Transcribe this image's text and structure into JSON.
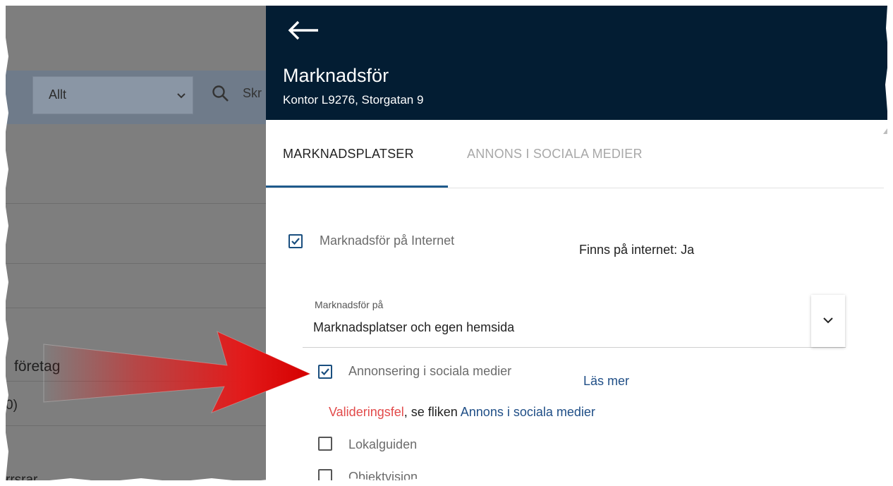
{
  "background": {
    "filter_select": "Allt",
    "search_partial": "Skr",
    "row_company": "företag",
    "row_count": "0)",
    "row_partial": "rrsrar"
  },
  "panel": {
    "title": "Marknadsför",
    "subtitle": "Kontor L9276, Storgatan 9",
    "tabs": [
      "MARKNADSPLATSER",
      "ANNONS I SOCIALA MEDIER"
    ],
    "active_tab": "MARKNADSPLATSER",
    "market_internet": {
      "label": "Marknadsför på Internet",
      "checked": true
    },
    "internet_status": "Finns på internet: Ja",
    "market_select": {
      "label": "Marknadsför på",
      "value": "Marknadsplatser och egen hemsida"
    },
    "social_ads": {
      "label": "Annonsering i sociala medier",
      "checked": true
    },
    "read_more": "Läs mer",
    "validation": {
      "error": "Valideringsfel",
      "text": ", se fliken ",
      "link": "Annons i sociala medier"
    },
    "local_guide": {
      "label": "Lokalguiden",
      "checked": false
    },
    "objektvision": {
      "label": "Objektvision",
      "checked": false
    }
  },
  "colors": {
    "header_bg": "#031d33",
    "accent": "#1f5a8c",
    "link": "#1f4e86",
    "error": "#e24a4a",
    "annotation_arrow": "#e31a1a"
  }
}
